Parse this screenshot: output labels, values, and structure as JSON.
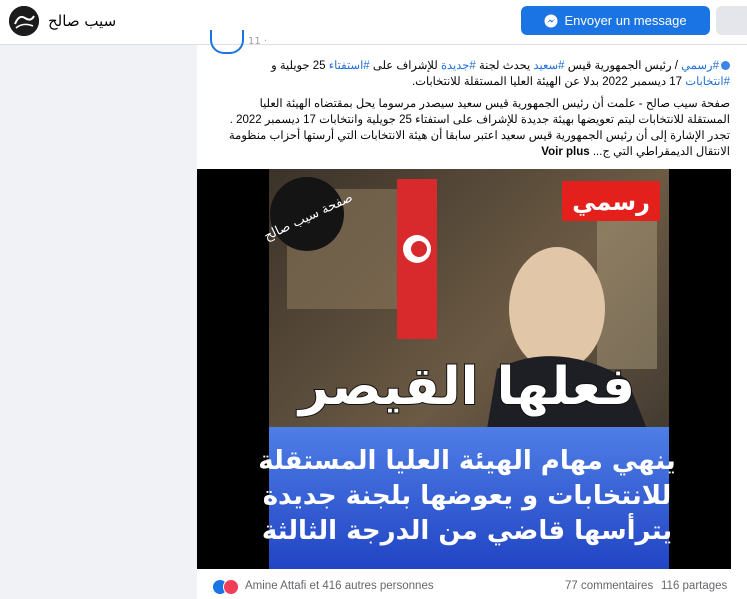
{
  "header": {
    "page_name": "سيب صالح",
    "message_button_label": "Envoyer un message",
    "brand_color": "#1b74e4"
  },
  "post": {
    "time_fragment": "11 ·",
    "line1": {
      "hashtag_official": "#رسمي",
      "sep": " / ",
      "t1": "رئيس الجمهورية  قيس ",
      "hashtag_saied": "#سعيد",
      "t2": " يحدث لجنة ",
      "hashtag_new": "#جديدة",
      "t3": " للإشراف على ",
      "hashtag_ref": "#استفتاء",
      "t4": " 25 جويلية و"
    },
    "line2": {
      "hashtag_elections": "#انتخابات",
      "t1": " 17 ديسمبر 2022 بدلا عن الهيئة العليا المستقلة للانتخابات."
    },
    "body": "صفحة سيب صالح - علمت أن رئيس الجمهورية قيس سعيد سيصدر مرسوما يحل بمقتضاه الهيئة العليا المستقلة للانتخابات ليتم تعويضها بهيئة جديدة للإشراف على استفتاء 25 جويلية وانتخابات 17 ديسمبر 2022 . تجدر الإشارة إلى أن رئيس الجمهورية قيس سعيد اعتبر سابقا أن هيئة الانتخابات التي أرستها أحزاب  منظومة الانتقال الديمقراطي التي ج...",
    "see_more": "Voir plus"
  },
  "image": {
    "badge": "رسمي",
    "watermark": "صفحة سيب صالح",
    "headline": "فعلها القيصر",
    "line1": "ينهي مهام الهيئة العليا المستقلة",
    "line2": "للانتخابات و يعوضها  بلجنة جديدة",
    "line3": "يترأسها قاضي من الدرجة الثالثة",
    "badge_color": "#e3201b",
    "text_panel_color": "#2b58d6"
  },
  "reactions": {
    "names": "Amine Attafi et 416 autres personnes",
    "comments": "77 commentaires",
    "shares": "116 partages"
  }
}
